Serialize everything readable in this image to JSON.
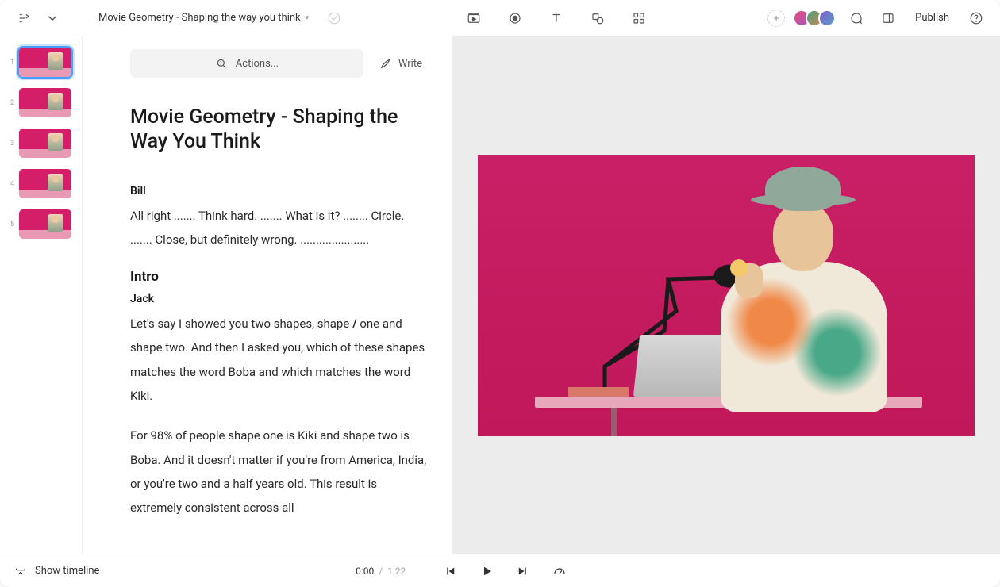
{
  "header": {
    "project_title": "Movie Geometry - Shaping the way you think",
    "publish_label": "Publish"
  },
  "toolbar": {
    "actions_label": "Actions...",
    "write_label": "Write"
  },
  "document": {
    "title": "Movie Geometry - Shaping the Way You Think",
    "blocks": {
      "speaker1": "Bill",
      "line1": "All right ....... Think hard. ....... What is it? ........ Circle. ....... Close, but definitely wrong. ......................",
      "section1": "Intro",
      "speaker2": "Jack",
      "line2a": "Let's say I showed you two shapes, shape ",
      "slash": "/",
      "line2b": " one and shape two. And then I asked you, which of these shapes matches the word Boba and which matches the word Kiki.",
      "line3": "For 98% of people shape one is Kiki and shape two is Boba. And it doesn't matter if you're from America, India, or you're two and a half years old. This result is extremely consistent across all"
    }
  },
  "thumbnails": {
    "ids": [
      "1",
      "2",
      "3",
      "4",
      "5"
    ]
  },
  "playback": {
    "show_timeline": "Show timeline",
    "current": "0:00",
    "sep": "/",
    "duration": "1:22"
  }
}
